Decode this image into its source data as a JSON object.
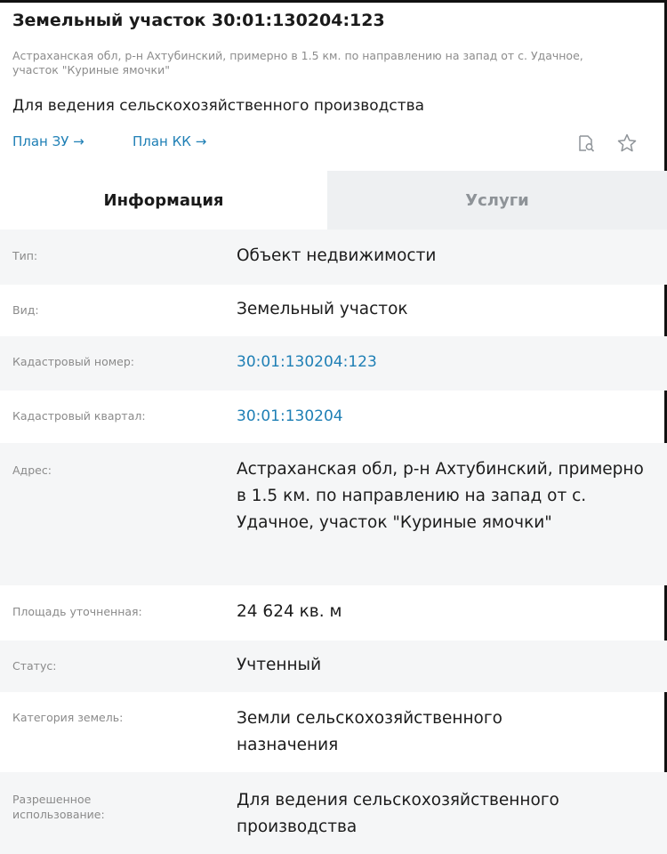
{
  "header": {
    "title": "Земельный участок 30:01:130204:123",
    "subtitle_address": "Астраханская обл, р-н Ахтубинский, примерно в 1.5 км. по направлению на запад от с. Удачное, участок \"Куриные ямочки\"",
    "purpose": "Для ведения сельскохозяйственного производства",
    "links": {
      "plan_zu": "План ЗУ →",
      "plan_kk": "План КК →"
    },
    "icons": [
      "document-preview-icon",
      "star-icon"
    ]
  },
  "tabs": {
    "info": "Информация",
    "services": "Услуги",
    "active": "info"
  },
  "details": {
    "type": {
      "label": "Тип:",
      "value": "Объект недвижимости"
    },
    "kind": {
      "label": "Вид:",
      "value": "Земельный участок"
    },
    "cadastral_number": {
      "label": "Кадастровый номер:",
      "value": "30:01:130204:123"
    },
    "cadastral_quarter": {
      "label": "Кадастровый квартал:",
      "value": "30:01:130204"
    },
    "address": {
      "label": "Адрес:",
      "value": "Астраханская обл, р-н Ахтубинский, примерно в 1.5 км. по направлению на запад от с. Удачное, участок \"Куриные ямочки\""
    },
    "area": {
      "label": "Площадь уточненная:",
      "value": "24 624 кв. м"
    },
    "status": {
      "label": "Статус:",
      "value": "Учтенный"
    },
    "land_category": {
      "label": "Категория земель:",
      "value": "Земли сельскохозяйственного назначения"
    },
    "permitted_use": {
      "label_line1": "Разрешенное",
      "label_line2": "использование:",
      "value": "Для ведения сельскохозяйственного производства"
    }
  },
  "colors": {
    "link": "#1e7fb5",
    "label": "#8a8a8a",
    "inactive_tab_bg": "#eef0f2"
  }
}
